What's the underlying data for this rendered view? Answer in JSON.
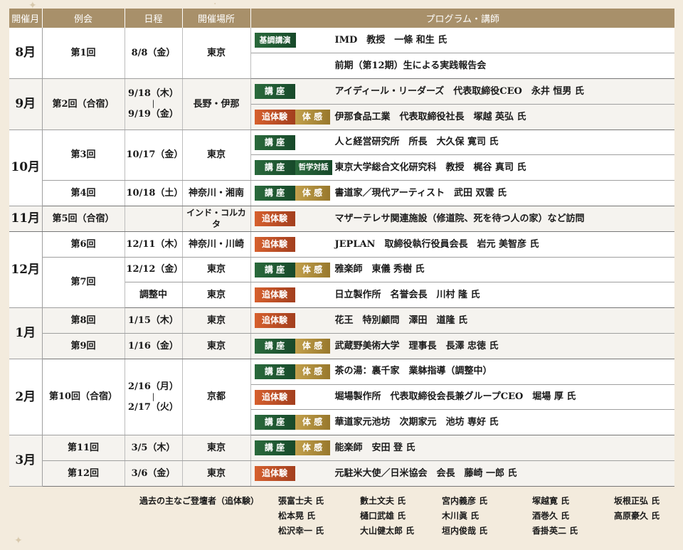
{
  "headers": [
    "開催月",
    "例会",
    "日程",
    "開催場所",
    "プログラム・講師"
  ],
  "months": {
    "aug": "8月",
    "sep": "9月",
    "oct": "10月",
    "nov": "11月",
    "dec": "12月",
    "jan": "1月",
    "feb": "2月",
    "mar": "3月"
  },
  "sessions": {
    "s1": "第1回",
    "s2": "第2回（合宿）",
    "s3": "第3回",
    "s4": "第4回",
    "s5": "第5回（合宿）",
    "s6": "第6回",
    "s7": "第7回",
    "s8": "第8回",
    "s9": "第9回",
    "s10": "第10回（合宿）",
    "s11": "第11回",
    "s12": "第12回"
  },
  "dates": {
    "d1": "8/8（金）",
    "d2a": "9/18（木）",
    "d2sep": "|",
    "d2b": "9/19（金）",
    "d3": "10/17（金）",
    "d4": "10/18（土）",
    "d6": "12/11（木）",
    "d7a": "12/12（金）",
    "d7b": "調整中",
    "d8": "1/15（木）",
    "d9": "1/16（金）",
    "d10a": "2/16（月）",
    "d10sep": "|",
    "d10b": "2/17（火）",
    "d11": "3/5（木）",
    "d12": "3/6（金）"
  },
  "places": {
    "tokyo": "東京",
    "nagano": "長野・伊那",
    "shonan": "神奈川・湘南",
    "kolkata": "インド・コルカタ",
    "kawasaki": "神奈川・川崎",
    "kyoto": "京都"
  },
  "tags": {
    "kichou": "基調講演",
    "kouza": "講 座",
    "taikan": "体 感",
    "tsui": "追体験",
    "tetsu": "哲学対話"
  },
  "programs": {
    "p1a": "IMD　教授　一條 和生 氏",
    "p1b": "前期（第12期）生による実践報告会",
    "p2a": "アイディール・リーダーズ　代表取締役CEO　永井 恒男 氏",
    "p2b": "伊那食品工業　代表取締役社長　塚越 英弘 氏",
    "p3a": "人と経営研究所　所長　大久保 寛司 氏",
    "p3b": "東京大学総合文化研究科　教授　梶谷 真司 氏",
    "p4": "書道家／現代アーティスト　武田 双雲 氏",
    "p5": "マザーテレサ関連施設（修道院、死を待つ人の家）など訪問",
    "p6": "JEPLAN　取締役執行役員会長　岩元 美智彦 氏",
    "p7a": "雅楽師　東儀 秀樹 氏",
    "p7b": "日立製作所　名誉会長　川村 隆 氏",
    "p8": "花王　特別顧問　澤田　道隆 氏",
    "p9": "武蔵野美術大学　理事長　長澤 忠徳 氏",
    "p10a": "茶の湯：裏千家　業躰指導（調整中）",
    "p10b": "堀場製作所　代表取締役会長兼グループCEO　堀場 厚 氏",
    "p10c": "華道家元池坊　次期家元　池坊 専好 氏",
    "p11": "能楽師　安田 登 氏",
    "p12": "元駐米大使／日米協会　会長　藤崎 一郎 氏"
  },
  "past": {
    "label": "過去の主なご登壇者（追体験）",
    "names": [
      "張富士夫 氏",
      "數土文夫 氏",
      "宮内義彦 氏",
      "塚越寛 氏",
      "坂根正弘 氏",
      "松本晃 氏",
      "樋口武雄 氏",
      "木川眞 氏",
      "酒巻久 氏",
      "高原豪久 氏",
      "松沢幸一 氏",
      "大山健太郎 氏",
      "垣内俊哉 氏",
      "香掛英二 氏"
    ]
  }
}
